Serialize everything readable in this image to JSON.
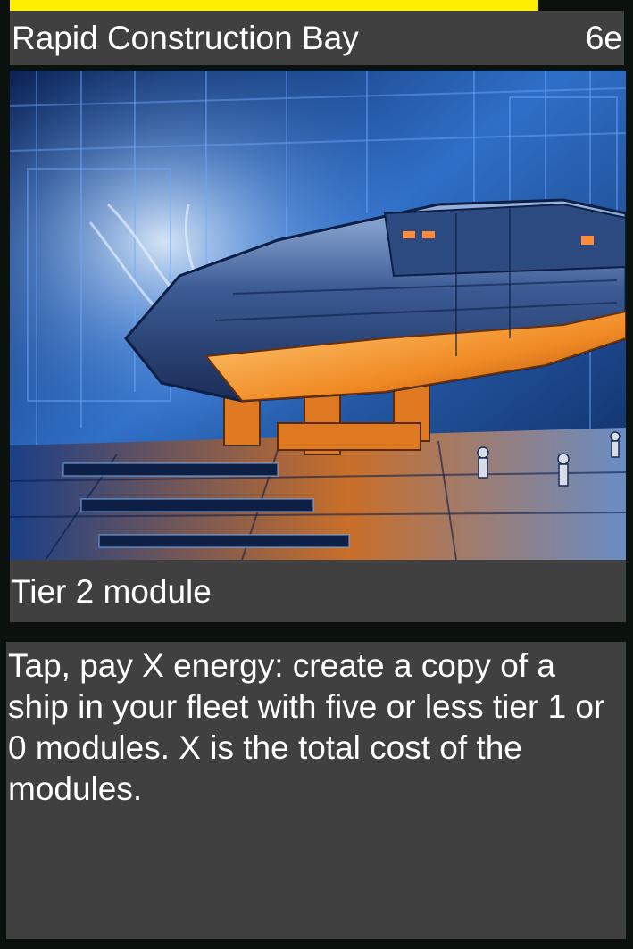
{
  "card": {
    "name": "Rapid Construction Bay",
    "cost": "6e",
    "type_line": "Tier 2 module",
    "rules_text": "Tap, pay X energy: create a copy of a ship in your fleet with five or less tier 1 or 0 modules. X is the total cost of the modules.",
    "progress": 0.86,
    "colors": {
      "progress_bar": "#ffee00",
      "panel": "#404040",
      "background": "#0b120e",
      "text": "#ffffff"
    },
    "art": {
      "subject": "spaceship-in-hangar",
      "palette": [
        "#0d2a66",
        "#3f7fd6",
        "#f08a24",
        "#ffc266"
      ]
    }
  }
}
